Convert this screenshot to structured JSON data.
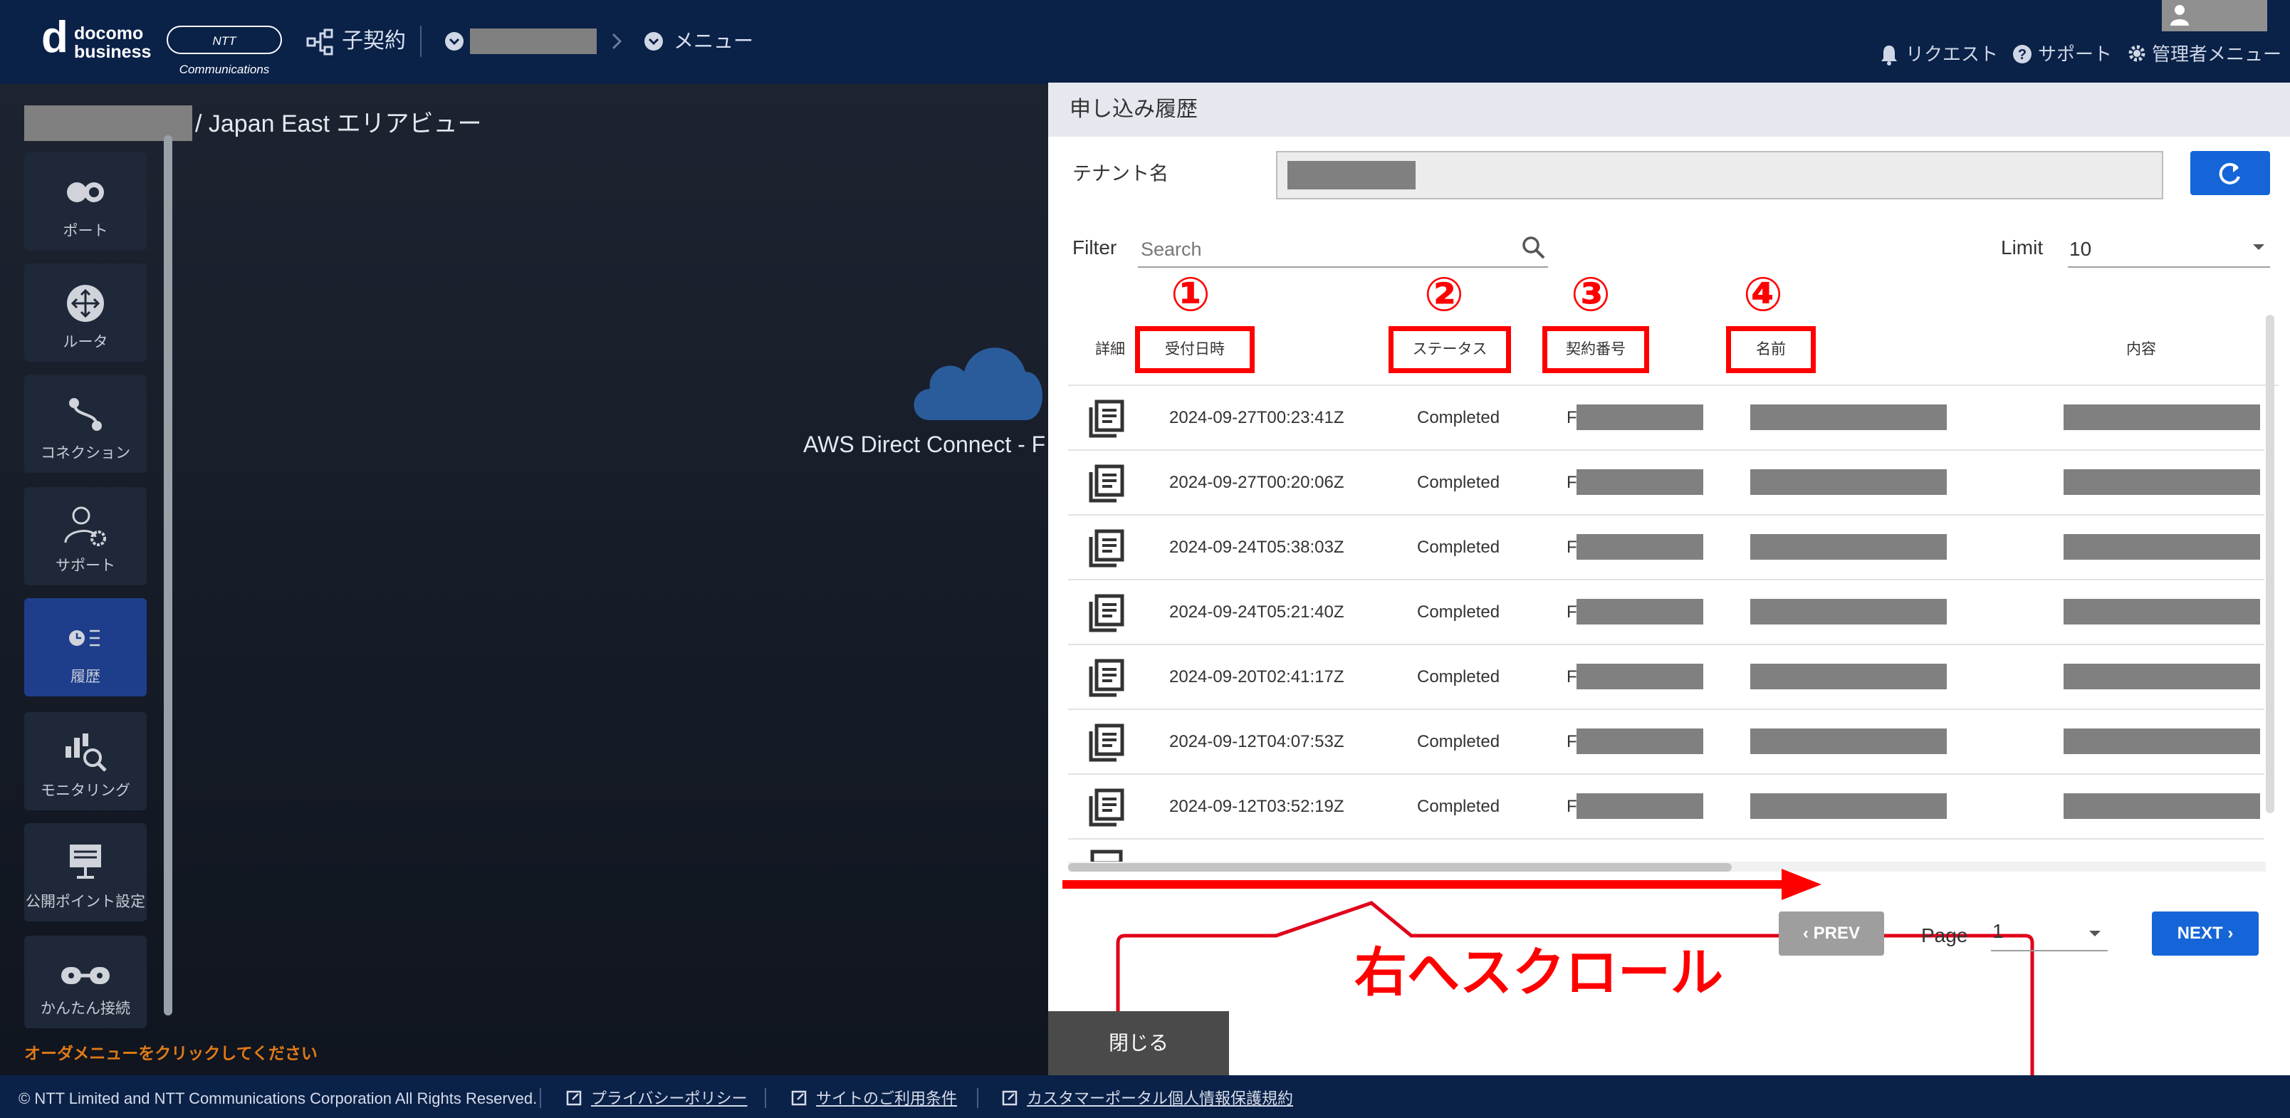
{
  "header": {
    "logo_d": "d",
    "logo_line1": "docomo",
    "logo_line2": "business",
    "logo_ntt": "NTT Communications",
    "child_contract": "子契約",
    "menu": "メニュー",
    "request": "リクエスト",
    "support": "サポート",
    "admin_menu": "管理者メニュー"
  },
  "breadcrumb": {
    "area": "/ Japan East エリアビュー"
  },
  "sidebar": {
    "items": [
      {
        "label": "ポート",
        "icon": "port-icon"
      },
      {
        "label": "ルータ",
        "icon": "router-icon"
      },
      {
        "label": "コネクション",
        "icon": "connection-icon"
      },
      {
        "label": "サポート",
        "icon": "support-icon"
      },
      {
        "label": "履歴",
        "icon": "history-icon"
      },
      {
        "label": "モニタリング",
        "icon": "monitoring-icon"
      },
      {
        "label": "公開ポイント設定",
        "icon": "public-point-icon"
      },
      {
        "label": "かんたん接続",
        "icon": "easy-connect-icon"
      }
    ],
    "hint": "オーダメニューをクリックしてください"
  },
  "canvas": {
    "aws_label": "AWS Direct Connect - F"
  },
  "dialog": {
    "title": "申し込み履歴",
    "tenant_label": "テナント名",
    "filter_label": "Filter",
    "search_placeholder": "Search",
    "limit_label": "Limit",
    "limit_value": "10",
    "columns": {
      "detail": "詳細",
      "received": "受付日時",
      "status": "ステータス",
      "contract_no": "契約番号",
      "name": "名前",
      "content": "内容"
    },
    "markers": [
      "①",
      "②",
      "③",
      "④"
    ],
    "rows": [
      {
        "received": "2024-09-27T00:23:41Z",
        "status": "Completed",
        "contract_prefix": "F"
      },
      {
        "received": "2024-09-27T00:20:06Z",
        "status": "Completed",
        "contract_prefix": "F"
      },
      {
        "received": "2024-09-24T05:38:03Z",
        "status": "Completed",
        "contract_prefix": "F"
      },
      {
        "received": "2024-09-24T05:21:40Z",
        "status": "Completed",
        "contract_prefix": "F"
      },
      {
        "received": "2024-09-20T02:41:17Z",
        "status": "Completed",
        "contract_prefix": "F"
      },
      {
        "received": "2024-09-12T04:07:53Z",
        "status": "Completed",
        "contract_prefix": "F"
      },
      {
        "received": "2024-09-12T03:52:19Z",
        "status": "Completed",
        "contract_prefix": "F"
      }
    ],
    "prev": "PREV",
    "page_label": "Page",
    "page_value": "1",
    "next": "NEXT",
    "close": "閉じる",
    "callout": "右へスクロール"
  },
  "footer": {
    "copyright": "© NTT Limited and NTT Communications Corporation All Rights Reserved.",
    "privacy": "プライバシーポリシー",
    "terms": "サイトのご利用条件",
    "personal_info": "カスタマーポータル個人情報保護規約"
  },
  "colors": {
    "header_bg": "#0a2148",
    "primary_button": "#1565d8",
    "annotation_red": "#ff0000",
    "active_sidebar": "#1e3e8c"
  }
}
